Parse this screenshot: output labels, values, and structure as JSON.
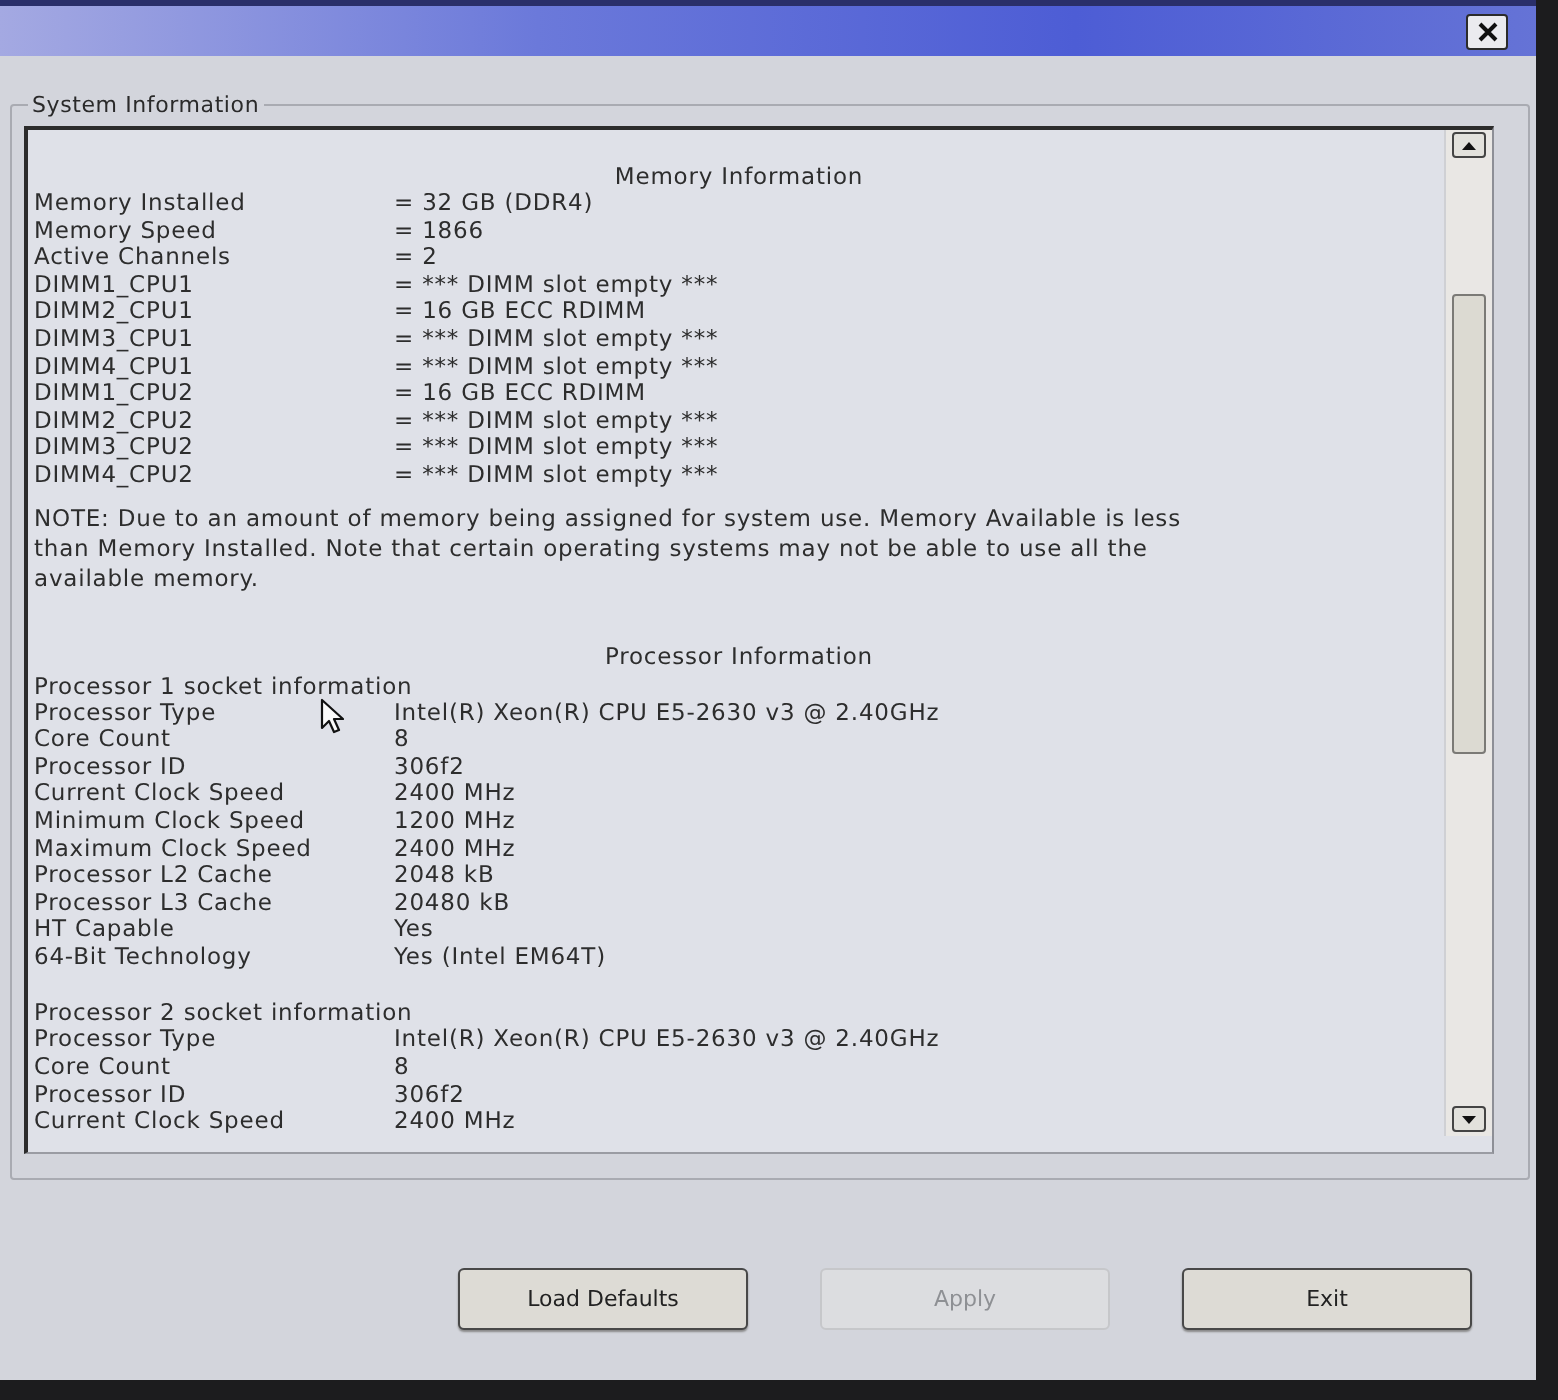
{
  "group_title": "System Information",
  "memory": {
    "heading": "Memory Information",
    "rows": [
      {
        "label": "Memory Installed",
        "value": "= 32 GB (DDR4)"
      },
      {
        "label": "Memory Speed",
        "value": "= 1866"
      },
      {
        "label": "Active Channels",
        "value": "= 2"
      },
      {
        "label": "DIMM1_CPU1",
        "value": "= *** DIMM slot empty ***"
      },
      {
        "label": "DIMM2_CPU1",
        "value": "= 16 GB ECC RDIMM"
      },
      {
        "label": "DIMM3_CPU1",
        "value": "= *** DIMM slot empty ***"
      },
      {
        "label": "DIMM4_CPU1",
        "value": "= *** DIMM slot empty ***"
      },
      {
        "label": "DIMM1_CPU2",
        "value": "= 16 GB ECC RDIMM"
      },
      {
        "label": "DIMM2_CPU2",
        "value": "= *** DIMM slot empty ***"
      },
      {
        "label": "DIMM3_CPU2",
        "value": "= *** DIMM slot empty ***"
      },
      {
        "label": "DIMM4_CPU2",
        "value": "= *** DIMM slot empty ***"
      }
    ]
  },
  "note": "NOTE: Due to an amount of memory being assigned for system use. Memory Available is less than Memory Installed. Note that certain operating systems may not be able to use all the available memory.",
  "processor": {
    "heading": "Processor Information",
    "sockets": [
      {
        "title": "Processor 1 socket information",
        "rows": [
          {
            "label": "Processor Type",
            "value": "Intel(R) Xeon(R) CPU E5-2630 v3 @ 2.40GHz"
          },
          {
            "label": "Core Count",
            "value": "8"
          },
          {
            "label": "Processor ID",
            "value": "306f2"
          },
          {
            "label": "Current Clock Speed",
            "value": "2400 MHz"
          },
          {
            "label": "Minimum Clock Speed",
            "value": "1200 MHz"
          },
          {
            "label": "Maximum Clock Speed",
            "value": "2400 MHz"
          },
          {
            "label": "Processor L2 Cache",
            "value": "2048 kB"
          },
          {
            "label": "Processor L3 Cache",
            "value": "20480 kB"
          },
          {
            "label": "HT Capable",
            "value": "Yes"
          },
          {
            "label": "64-Bit Technology",
            "value": "Yes (Intel EM64T)"
          }
        ]
      },
      {
        "title": "Processor 2 socket information",
        "rows": [
          {
            "label": "Processor Type",
            "value": "Intel(R) Xeon(R) CPU E5-2630 v3 @ 2.40GHz"
          },
          {
            "label": "Core Count",
            "value": "8"
          },
          {
            "label": "Processor ID",
            "value": "306f2"
          },
          {
            "label": "Current Clock Speed",
            "value": "2400 MHz"
          }
        ]
      }
    ]
  },
  "buttons": [
    {
      "label": "Load Defaults",
      "disabled": false
    },
    {
      "label": "Apply",
      "disabled": true
    },
    {
      "label": "Exit",
      "disabled": false
    }
  ]
}
